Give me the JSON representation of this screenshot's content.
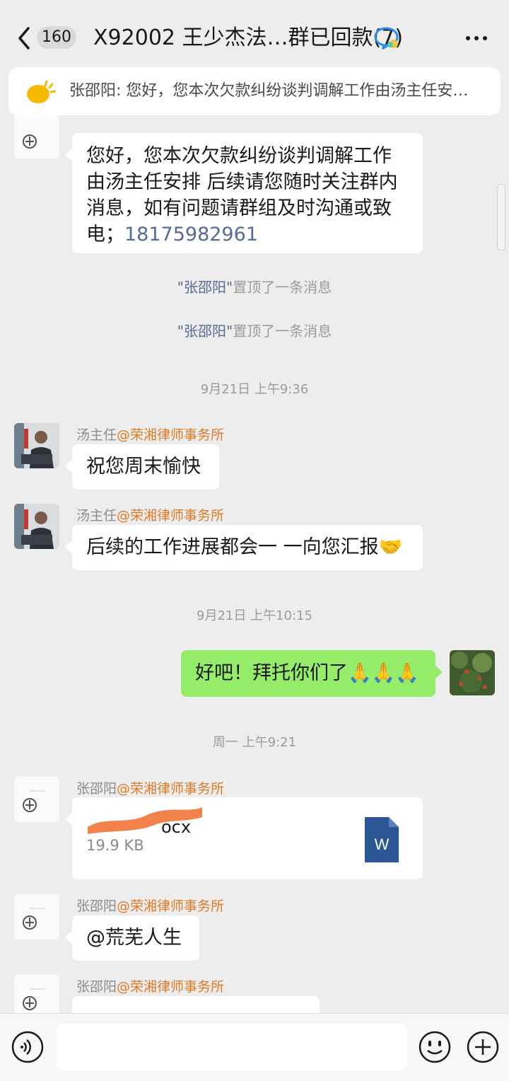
{
  "header": {
    "unread_count": "160",
    "title": "X92002 王少杰法…群已回款(7)"
  },
  "pinned": {
    "text": "张邵阳: 您好，您本次欠款纠纷谈判调解工作由汤主任安…"
  },
  "messages": {
    "m1": {
      "lines": [
        "您好，您本次欠款纠纷谈判调解工作",
        "由汤主任安排 后续请您随时关注群内",
        "消息，如有问题请群组及时沟通或致"
      ],
      "last_prefix": "电；",
      "phone": "18175982961"
    },
    "sys1": {
      "who": "\"张邵阳\"",
      "action": "置顶了一条消息"
    },
    "sys2": {
      "who": "\"张邵阳\"",
      "action": "置顶了一条消息"
    },
    "time1": "9月21日 上午9:36",
    "m2": {
      "name": "汤主任",
      "org": "@荣湘律师事务所",
      "text": "祝您周末愉快"
    },
    "m3": {
      "name": "汤主任",
      "org": "@荣湘律师事务所",
      "text": "后续的工作进展都会一 一向您汇报",
      "emoji": "🤝"
    },
    "time2": "9月21日 上午10:15",
    "m4": {
      "text": "好吧！拜托你们了",
      "emoji": "🙏🙏🙏"
    },
    "time3": "周一 上午9:21",
    "m5": {
      "name": "张邵阳",
      "org": "@荣湘律师事务所",
      "file_name_visible": "ocx",
      "file_size": "19.9 KB",
      "file_icon_letter": "W"
    },
    "m6": {
      "name": "张邵阳",
      "org": "@荣湘律师事务所",
      "text": "@荒芜人生"
    },
    "m7": {
      "name": "张邵阳",
      "org": "@荣湘律师事务所"
    }
  },
  "colors": {
    "background": "#ededed",
    "bubble_self": "#95ec69",
    "org_highlight": "#e07a24",
    "link": "#576b95",
    "word_icon": "#2b5797"
  },
  "icons": [
    "back-arrow-icon",
    "group-chat-icon",
    "more-icon",
    "sun-icon",
    "voice-icon",
    "emoji-icon",
    "plus-icon",
    "word-file-icon"
  ]
}
